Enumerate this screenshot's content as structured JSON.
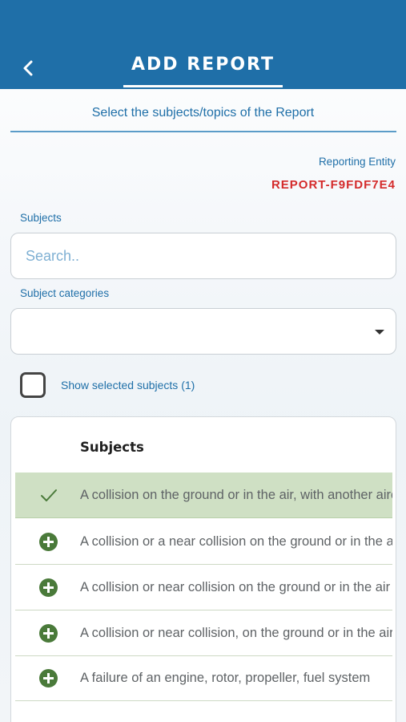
{
  "header": {
    "title": "ADD REPORT",
    "back_icon": "chevron-left-icon",
    "background_color": "#1f6fa8"
  },
  "step": {
    "label": "Select the subjects/topics of the Report"
  },
  "reporting_entity": {
    "label": "Reporting Entity",
    "report_id": "REPORT-F9FDF7E4",
    "report_id_color": "#d42b2b"
  },
  "subjects_field": {
    "label": "Subjects",
    "placeholder": "Search.."
  },
  "categories_field": {
    "label": "Subject categories",
    "value": ""
  },
  "show_selected": {
    "label": "Show selected subjects (1)",
    "checked": false
  },
  "table": {
    "header": "Subjects",
    "rows": [
      {
        "text": "A collision on the ground or in the air, with another aircraft",
        "selected": true,
        "icon": "check-icon"
      },
      {
        "text": "A collision or a near collision on the ground or in the air",
        "selected": false,
        "icon": "add-circle-icon"
      },
      {
        "text": "A collision or near collision on the ground or in the air",
        "selected": false,
        "icon": "add-circle-icon"
      },
      {
        "text": "A collision or near collision, on the ground or in the air",
        "selected": false,
        "icon": "add-circle-icon"
      },
      {
        "text": "A failure of an engine, rotor, propeller, fuel system",
        "selected": false,
        "icon": "add-circle-icon"
      }
    ]
  },
  "colors": {
    "accent": "#1f6fa8",
    "selected_row": "#cfe0c4",
    "add_icon": "#4a7a3a"
  }
}
